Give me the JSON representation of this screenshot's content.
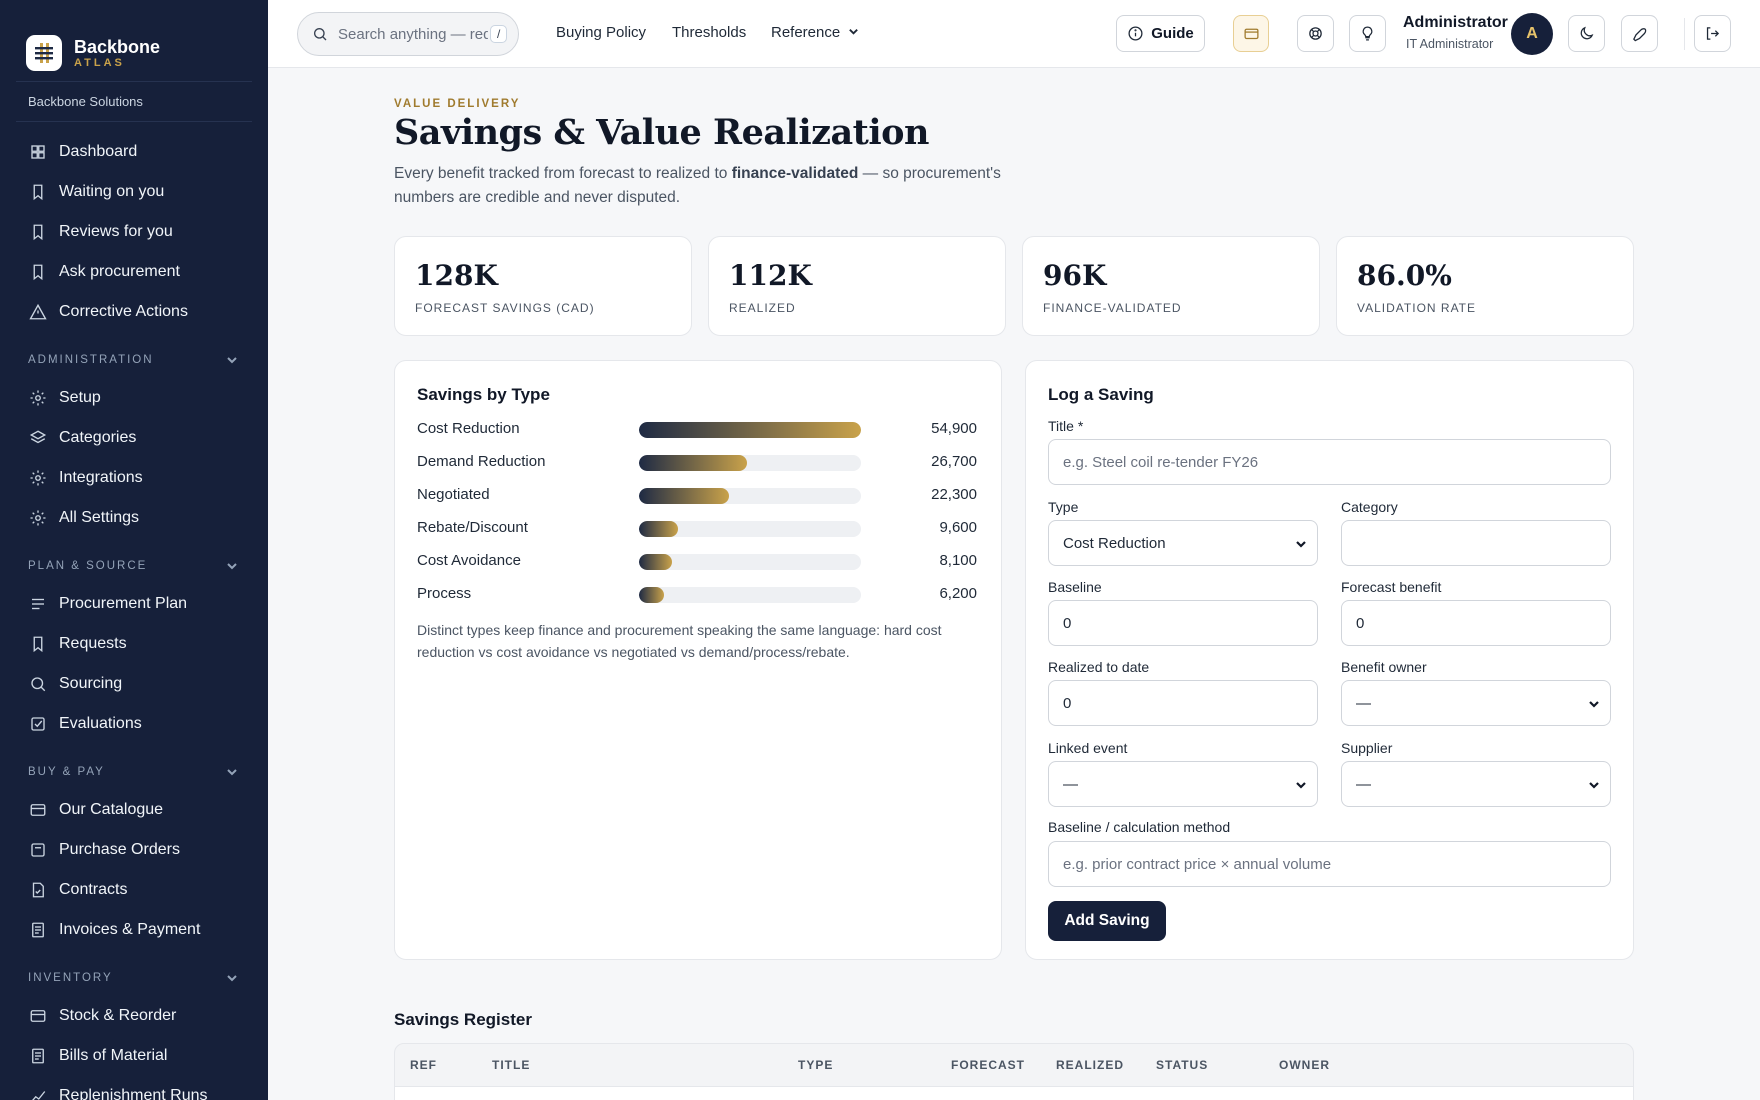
{
  "brand": {
    "name": "Backbone",
    "sub": "ATLAS",
    "org": "Backbone Solutions"
  },
  "sidebar": {
    "top_items": [
      {
        "label": "Dashboard",
        "icon": "grid-icon"
      },
      {
        "label": "Waiting on you",
        "icon": "bookmark-icon"
      },
      {
        "label": "Reviews for you",
        "icon": "bookmark-icon"
      },
      {
        "label": "Ask procurement",
        "icon": "bookmark-icon"
      },
      {
        "label": "Corrective Actions",
        "icon": "warning-icon"
      }
    ],
    "sections": [
      {
        "title": "ADMINISTRATION",
        "items": [
          {
            "label": "Setup",
            "icon": "gear-icon"
          },
          {
            "label": "Categories",
            "icon": "layers-icon"
          },
          {
            "label": "Integrations",
            "icon": "gear-icon"
          },
          {
            "label": "All Settings",
            "icon": "gear-icon"
          }
        ]
      },
      {
        "title": "PLAN & SOURCE",
        "items": [
          {
            "label": "Procurement Plan",
            "icon": "list-icon"
          },
          {
            "label": "Requests",
            "icon": "bookmark-icon"
          },
          {
            "label": "Sourcing",
            "icon": "search-icon"
          },
          {
            "label": "Evaluations",
            "icon": "check-square-icon"
          }
        ]
      },
      {
        "title": "BUY & PAY",
        "items": [
          {
            "label": "Our Catalogue",
            "icon": "catalogue-icon"
          },
          {
            "label": "Purchase Orders",
            "icon": "box-icon"
          },
          {
            "label": "Contracts",
            "icon": "file-check-icon"
          },
          {
            "label": "Invoices & Payment",
            "icon": "receipt-icon"
          }
        ]
      },
      {
        "title": "INVENTORY",
        "items": [
          {
            "label": "Stock & Reorder",
            "icon": "catalogue-icon"
          },
          {
            "label": "Bills of Material",
            "icon": "receipt-icon"
          },
          {
            "label": "Replenishment Runs",
            "icon": "chart-icon"
          }
        ]
      }
    ]
  },
  "topbar": {
    "search_placeholder": "Search anything — req",
    "search_shortcut": "/",
    "links": [
      "Buying Policy",
      "Thresholds",
      "Reference"
    ],
    "guide_label": "Guide",
    "user_name": "Administrator",
    "user_role": "IT Administrator",
    "avatar_initial": "A"
  },
  "page": {
    "eyebrow": "VALUE DELIVERY",
    "title": "Savings & Value Realization",
    "desc_pre": "Every benefit tracked from forecast to realized to ",
    "desc_bold": "finance-validated",
    "desc_post": " — so procurement's numbers are credible and never disputed."
  },
  "kpis": [
    {
      "value": "128K",
      "label": "FORECAST SAVINGS (CAD)"
    },
    {
      "value": "112K",
      "label": "REALIZED"
    },
    {
      "value": "96K",
      "label": "FINANCE-VALIDATED"
    },
    {
      "value": "86.0%",
      "label": "VALIDATION RATE"
    }
  ],
  "chart_data": {
    "type": "bar",
    "title": "Savings by Type",
    "categories": [
      "Cost Reduction",
      "Demand Reduction",
      "Negotiated",
      "Rebate/Discount",
      "Cost Avoidance",
      "Process"
    ],
    "values": [
      54900,
      26700,
      22300,
      9600,
      8100,
      6200
    ],
    "value_labels": [
      "54,900",
      "26,700",
      "22,300",
      "9,600",
      "8,100",
      "6,200"
    ],
    "xlim": [
      0,
      54900
    ],
    "colors": {
      "start": "#1e2a44",
      "end": "#c9a24a"
    }
  },
  "savings_note": "Distinct types keep finance and procurement speaking the same language: hard cost reduction vs cost avoidance vs negotiated vs demand/process/rebate.",
  "form": {
    "title": "Log a Saving",
    "title_label": "Title *",
    "title_placeholder": "e.g. Steel coil re-tender FY26",
    "type_label": "Type",
    "type_value": "Cost Reduction",
    "category_label": "Category",
    "category_value": "",
    "baseline_label": "Baseline",
    "baseline_value": "0",
    "forecast_label": "Forecast benefit",
    "forecast_value": "0",
    "realized_label": "Realized to date",
    "realized_value": "0",
    "owner_label": "Benefit owner",
    "owner_value": "—",
    "event_label": "Linked event",
    "event_value": "—",
    "supplier_label": "Supplier",
    "supplier_value": "—",
    "method_label": "Baseline / calculation method",
    "method_placeholder": "e.g. prior contract price × annual volume",
    "submit_label": "Add Saving"
  },
  "register": {
    "title": "Savings Register",
    "columns": [
      "REF",
      "TITLE",
      "TYPE",
      "FORECAST",
      "REALIZED",
      "STATUS",
      "OWNER"
    ]
  },
  "colors": {
    "sidebar": "#16203a",
    "accent": "#c9a24a",
    "primary": "#16203a"
  }
}
